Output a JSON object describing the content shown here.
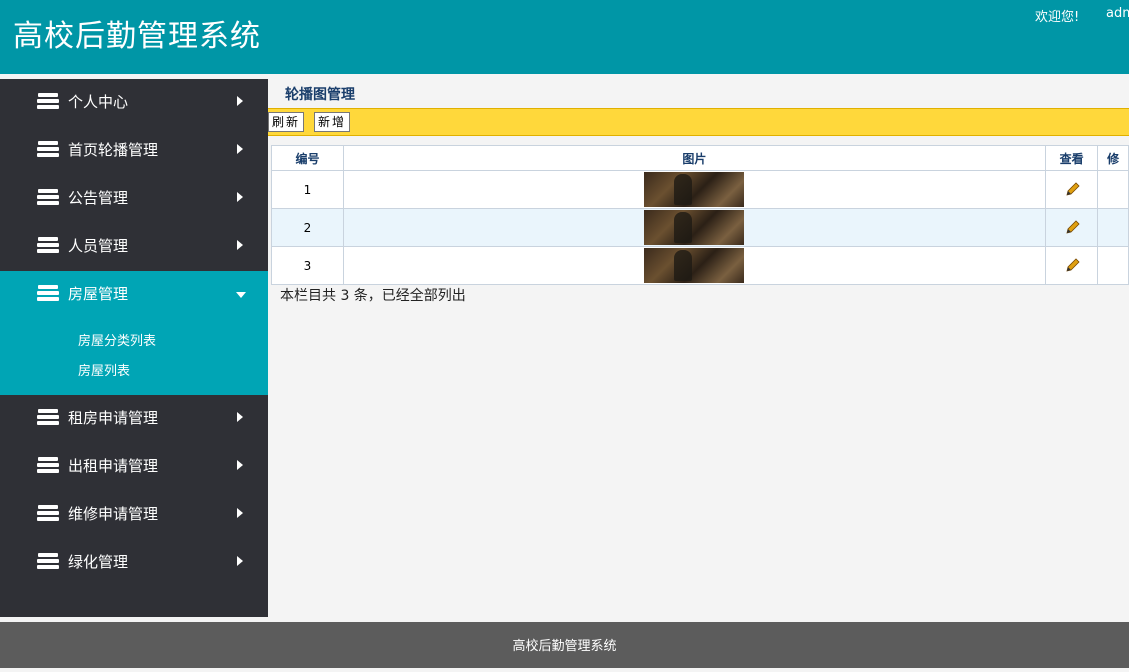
{
  "header": {
    "title": "高校后勤管理系统",
    "welcome": "欢迎您!",
    "user": "adm"
  },
  "sidebar": {
    "items": [
      {
        "label": "个人中心",
        "icon": "stack-icon",
        "arrow": "right"
      },
      {
        "label": "首页轮播管理",
        "icon": "stack-icon",
        "arrow": "right"
      },
      {
        "label": "公告管理",
        "icon": "stack-icon",
        "arrow": "right"
      },
      {
        "label": "人员管理",
        "icon": "stack-icon",
        "arrow": "right"
      },
      {
        "label": "房屋管理",
        "icon": "stack-icon",
        "arrow": "down",
        "active": true,
        "children": [
          "房屋分类列表",
          "房屋列表"
        ]
      },
      {
        "label": "租房申请管理",
        "icon": "stack-icon",
        "arrow": "right"
      },
      {
        "label": "出租申请管理",
        "icon": "stack-icon",
        "arrow": "right"
      },
      {
        "label": "维修申请管理",
        "icon": "stack-icon",
        "arrow": "right"
      },
      {
        "label": "绿化管理",
        "icon": "stack-icon",
        "arrow": "right"
      }
    ]
  },
  "main": {
    "heading": "轮播图管理",
    "toolbar": {
      "refresh": "刷新",
      "add": "新增"
    },
    "table": {
      "columns": [
        "编号",
        "图片",
        "查看",
        "修"
      ],
      "rows": [
        {
          "id": "1",
          "image": "carousel-thumbnail"
        },
        {
          "id": "2",
          "image": "carousel-thumbnail"
        },
        {
          "id": "3",
          "image": "carousel-thumbnail"
        }
      ]
    },
    "summary": "本栏目共 3 条，已经全部列出"
  },
  "footer": {
    "text": "高校后勤管理系统"
  },
  "colors": {
    "header_bg": "#0096a6",
    "sidebar_bg": "#2f3036",
    "active_bg": "#00a5b5",
    "toolbar_bg": "#ffd83b",
    "footer_bg": "#5c5c5c"
  }
}
